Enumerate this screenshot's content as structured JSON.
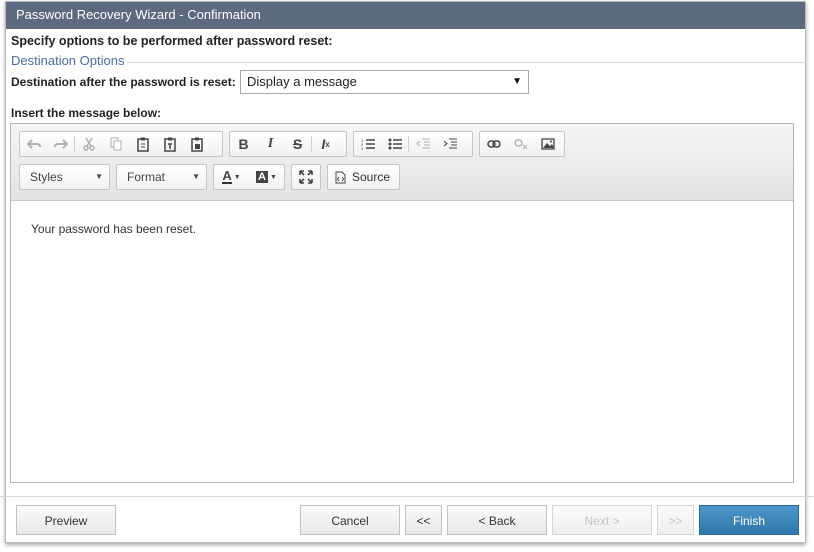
{
  "window": {
    "title": "Password Recovery Wizard - Confirmation"
  },
  "form": {
    "heading": "Specify options to be performed after password reset:",
    "section_title": "Destination Options",
    "destination_label": "Destination after the password is reset:",
    "destination_value": "Display a message",
    "insert_label": "Insert the message below:"
  },
  "editor": {
    "styles_label": "Styles",
    "format_label": "Format",
    "source_label": "Source",
    "content": "Your password has been reset."
  },
  "buttons": {
    "preview": "Preview",
    "cancel": "Cancel",
    "first": "<<",
    "back": "< Back",
    "next": "Next >",
    "last": ">>",
    "finish": "Finish"
  }
}
